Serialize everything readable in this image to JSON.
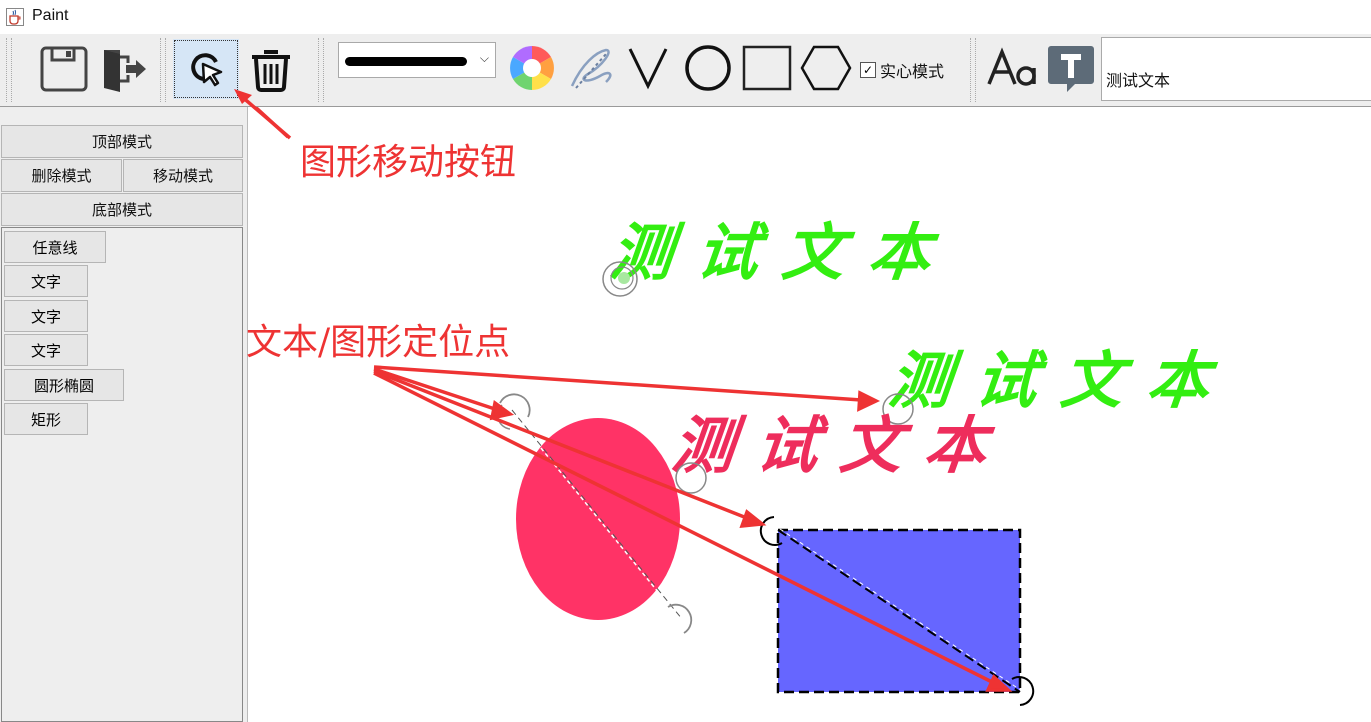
{
  "window": {
    "title": "Paint",
    "app_icon": "java-cup-icon"
  },
  "toolbar": {
    "buttons": [
      {
        "name": "save-button",
        "icon": "floppy-disk-icon"
      },
      {
        "name": "exit-button",
        "icon": "exit-door-icon"
      },
      {
        "name": "move-shape-button",
        "icon": "cursor-move-icon",
        "selected": true
      },
      {
        "name": "delete-button",
        "icon": "trash-icon"
      },
      {
        "name": "color-picker-button",
        "icon": "color-wheel-icon"
      },
      {
        "name": "freehand-button",
        "icon": "scribble-icon"
      },
      {
        "name": "line-button",
        "icon": "v-line-icon"
      },
      {
        "name": "ellipse-button",
        "icon": "circle-icon"
      },
      {
        "name": "rectangle-button",
        "icon": "square-icon"
      },
      {
        "name": "polygon-button",
        "icon": "hexagon-icon"
      },
      {
        "name": "font-button",
        "icon": "font-aa-icon"
      },
      {
        "name": "text-tool-button",
        "icon": "text-t-icon"
      }
    ],
    "solid_mode_label": "实心模式",
    "solid_mode_checked": true,
    "text_value": "测试文本"
  },
  "sidebar": {
    "top_mode": "顶部模式",
    "delete_mode": "删除模式",
    "move_mode": "移动模式",
    "bottom_mode": "底部模式",
    "layers": [
      "任意线",
      "文字",
      "文字",
      "文字",
      "圆形椭圆",
      "矩形"
    ]
  },
  "canvas": {
    "texts": [
      {
        "text": "测试文本",
        "color": "#33ee11"
      },
      {
        "text": "测试文本",
        "color": "#33ee11"
      },
      {
        "text": "测试文本",
        "color": "#ee2d5c"
      }
    ],
    "ellipse_color": "#ff3366",
    "rect_color": "#6666ff"
  },
  "annotations": {
    "move_button_label": "图形移动按钮",
    "anchor_label": "文本/图形定位点",
    "color": "#ee3333"
  }
}
